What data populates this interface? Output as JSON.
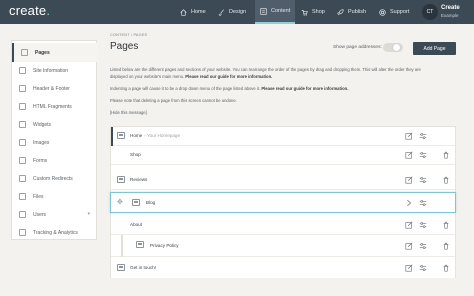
{
  "app": {
    "logo": "create",
    "logo_dot": "."
  },
  "nav": [
    {
      "label": "Home",
      "icon": "home-icon"
    },
    {
      "label": "Design",
      "icon": "brush-icon"
    },
    {
      "label": "Content",
      "icon": "content-icon",
      "active": true
    },
    {
      "label": "Shop",
      "icon": "cart-icon"
    },
    {
      "label": "Publish",
      "icon": "rocket-icon"
    },
    {
      "label": "Support",
      "icon": "lifebuoy-icon"
    }
  ],
  "account": {
    "initials": "CT",
    "name": "Create",
    "sub": "Example"
  },
  "sidebar": {
    "items": [
      {
        "label": "Pages",
        "active": true
      },
      {
        "label": "Site Information"
      },
      {
        "label": "Header & Footer"
      },
      {
        "label": "HTML Fragments"
      },
      {
        "label": "Widgets"
      },
      {
        "label": "Images"
      },
      {
        "label": "Forms"
      },
      {
        "label": "Custom Redirects"
      },
      {
        "label": "Files"
      },
      {
        "label": "Users",
        "has_chevron": true
      },
      {
        "label": "Tracking & Analytics"
      }
    ]
  },
  "breadcrumb": {
    "root": "CONTENT",
    "sep": "/",
    "current": "PAGES"
  },
  "page_title": "Pages",
  "controls": {
    "show_addresses_label": "Show page addresses:",
    "add_page_label": "Add Page"
  },
  "info": {
    "line1": "Listed below are the different pages and sections of your website. You can rearrange the order of the pages by drag and dropping them. This will alter the order they are",
    "line2_a": "displayed on your website's main menu.",
    "line2_b": "Please read our guide for more information.",
    "line3_a": "Indenting a page will cause it to be a drop down menu of the page listed above it.",
    "line3_b": "Please read our guide for more information.",
    "line4": "Please note that deleting a page from this screen cannot be undone.",
    "hide": "[Hide this message]"
  },
  "pages": [
    {
      "title": "Home",
      "subtitle": "- Your Homepage",
      "level": 0,
      "home": true
    },
    {
      "title": "Shop",
      "subtitle": "",
      "level": 0
    },
    {
      "title": "Reviews",
      "subtitle": "",
      "level": 0
    },
    {
      "title": "Blog",
      "subtitle": "",
      "level": 0,
      "dragging": true
    },
    {
      "title": "About",
      "subtitle": "",
      "level": 0
    },
    {
      "title": "Privacy Policy",
      "subtitle": "",
      "level": 1
    },
    {
      "title": "Get in touch!",
      "subtitle": "",
      "level": 0
    }
  ]
}
